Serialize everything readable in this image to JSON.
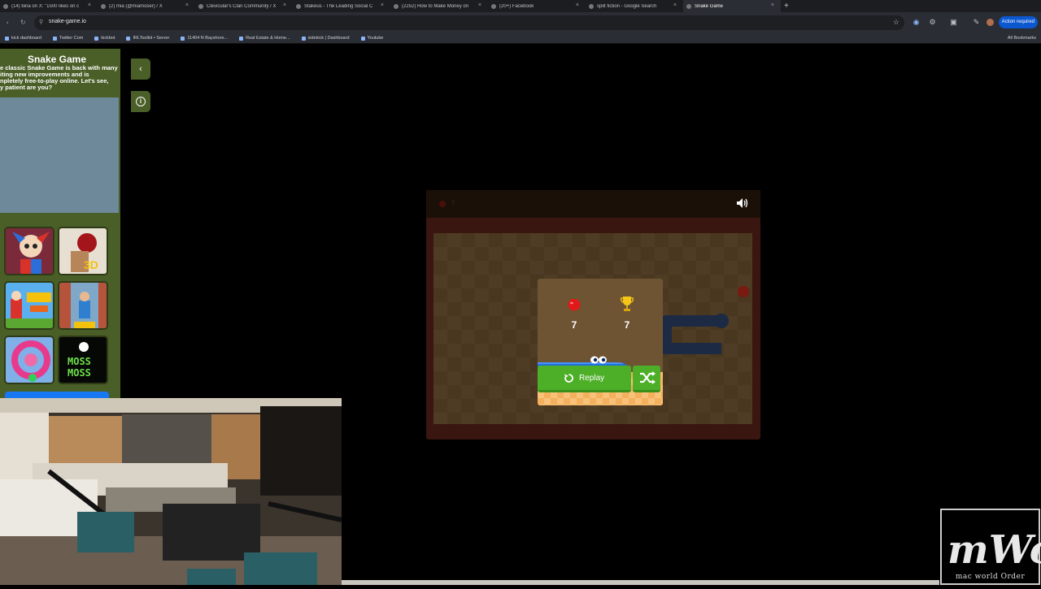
{
  "browser": {
    "tabs": [
      {
        "title": "(14) bina on X: \"1500 likes on c",
        "active": false
      },
      {
        "title": "(2) mia (@miamoser) / X",
        "active": false
      },
      {
        "title": "Clevicular's Clan Community / X",
        "active": false
      },
      {
        "title": "Stakeus - The Leading Social C",
        "active": false
      },
      {
        "title": "(2252) How to Make Money on",
        "active": false
      },
      {
        "title": "(20+) Facebook",
        "active": false
      },
      {
        "title": "split fiction - Google Search",
        "active": false
      },
      {
        "title": "Snake Game",
        "active": true
      }
    ],
    "new_tab": "+",
    "close_glyph": "×",
    "url": "snake-game.io",
    "action_required": "Action required",
    "bookmarks": [
      "kick dashboard",
      "Twitter Com",
      "kickbot",
      "IRLToolkit • Server",
      "11404 N Bayshore...",
      "Real Estate & Home...",
      "sidekick | Dashboard",
      "Youtube"
    ],
    "all_bookmarks": "All Bookmarks",
    "icons": {
      "back": "‹",
      "reload": "↻",
      "star": "☆",
      "ext1": "◉",
      "ext2": "⚙",
      "ext3": "▣",
      "ext4": "⋮"
    }
  },
  "sidebar": {
    "title": "Snake Game",
    "description": "e classic Snake Game is back with many\niting new improvements and is\nnpletely free-to-play online. Let's see,\ny patient are you?",
    "collapse_glyph": "‹",
    "info_glyph": "i",
    "games": [
      "pomni",
      "tung-sahur-3d",
      "blocky-world",
      "runner",
      "spiral-ball",
      "moss-moss"
    ]
  },
  "game": {
    "header_score": "7",
    "score": "7",
    "best": "7",
    "replay_label": "Replay",
    "colors": {
      "snake": "#1f6fe0",
      "button": "#4caf27",
      "apple": "#e0191a"
    }
  },
  "watermark": {
    "logo": "mWo",
    "tagline": "mac world Order"
  }
}
